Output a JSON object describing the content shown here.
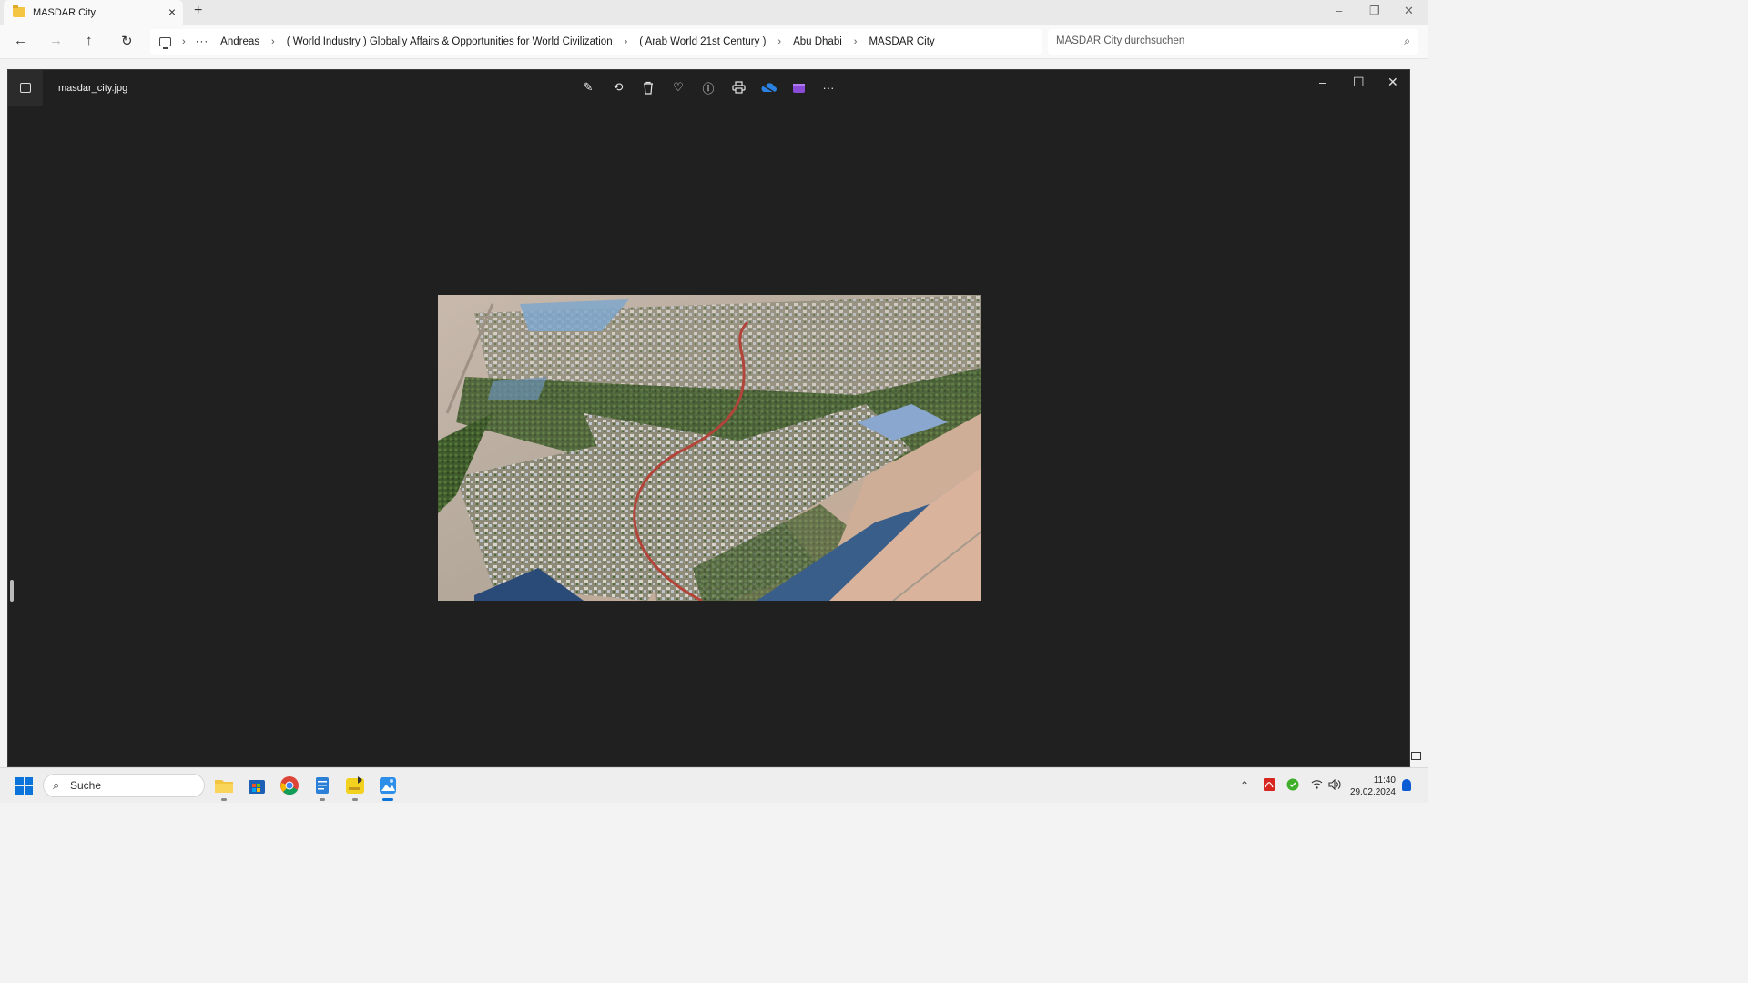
{
  "explorer": {
    "tab_title": "MASDAR City",
    "new_tab_label": "+",
    "window_controls": {
      "minimize": "–",
      "restore": "❐",
      "close": "✕"
    },
    "nav": {
      "back": "←",
      "forward": "→",
      "up": "↑",
      "refresh": "↻",
      "more": "···"
    },
    "breadcrumbs": [
      "Andreas",
      "( World Industry ) Globally Affairs & Opportunities for World Civilization",
      "( Arab World 21st Century )",
      "Abu Dhabi",
      "MASDAR City"
    ],
    "search_placeholder": "MASDAR City durchsuchen"
  },
  "viewer": {
    "file_name": "masdar_city.jpg",
    "toolbar": [
      {
        "name": "edit-image-icon",
        "glyph": "✎"
      },
      {
        "name": "rotate-icon",
        "glyph": "⟲"
      },
      {
        "name": "delete-icon",
        "glyph": "🗑"
      },
      {
        "name": "favorite-icon",
        "glyph": "♡"
      },
      {
        "name": "info-icon",
        "glyph": "ⓘ"
      },
      {
        "name": "print-icon",
        "glyph": "⎙"
      },
      {
        "name": "onedrive-icon",
        "glyph": ""
      },
      {
        "name": "clipchamp-icon",
        "glyph": ""
      },
      {
        "name": "more-options-icon",
        "glyph": "···"
      }
    ],
    "window_controls": {
      "minimize": "–",
      "maximize": "☐",
      "close": "✕"
    }
  },
  "taskbar": {
    "search_placeholder": "Suche",
    "apps": [
      {
        "name": "file-explorer-icon",
        "color": "#f4c542"
      },
      {
        "name": "microsoft-store-icon",
        "color": "#1d5fb4"
      },
      {
        "name": "chrome-icon",
        "color": "#db4437"
      },
      {
        "name": "notepad-icon",
        "color": "#2c7fd6"
      },
      {
        "name": "player-app-icon",
        "color": "#f2d21f"
      },
      {
        "name": "photos-app-icon",
        "color": "#2e8fe8"
      }
    ],
    "time": "11:40",
    "date": "29.02.2024"
  },
  "colors": {
    "accent": "#0a74da",
    "viewer_bg": "#202020",
    "explorer_bg": "#f9f9f9"
  }
}
